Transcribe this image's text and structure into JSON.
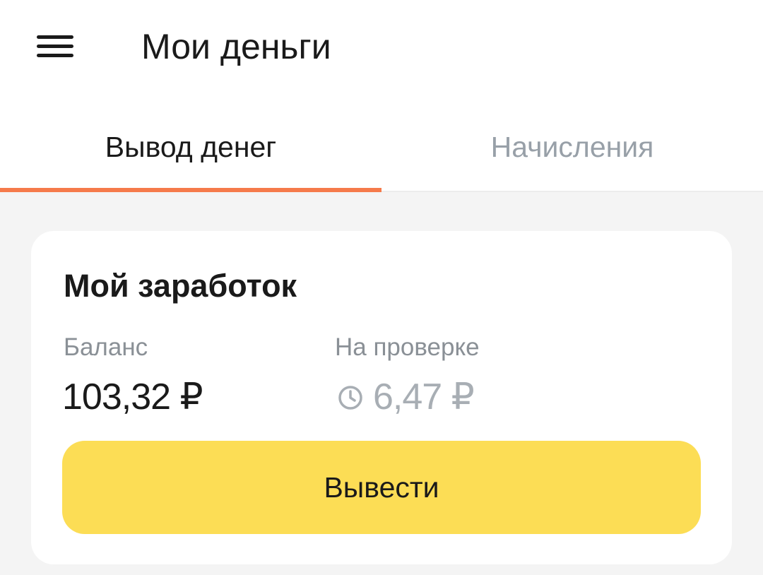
{
  "appbar": {
    "title": "Мои деньги"
  },
  "tabs": [
    {
      "label": "Вывод денег",
      "active": true
    },
    {
      "label": "Начисления",
      "active": false
    }
  ],
  "earnings": {
    "title": "Мой заработок",
    "balance_label": "Баланс",
    "balance_value": "103,32 ₽",
    "review_label": "На проверке",
    "review_value": "6,47 ₽",
    "review_icon": "clock-icon",
    "withdraw_label": "Вывести"
  },
  "colors": {
    "accent_indicator": "#f57a4a",
    "primary_button": "#fcdd55",
    "muted_text": "#a8aeb4"
  }
}
